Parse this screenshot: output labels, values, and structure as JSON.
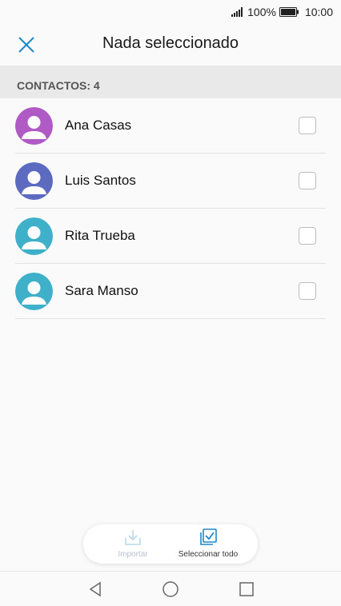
{
  "status_bar": {
    "battery_percent": "100%",
    "time": "10:00"
  },
  "app_bar": {
    "title": "Nada seleccionado",
    "close_icon": "close-icon"
  },
  "section": {
    "label": "CONTACTOS: 4"
  },
  "contacts": [
    {
      "name": "Ana Casas",
      "avatar_color": "#b05ac6",
      "checked": false
    },
    {
      "name": "Luis Santos",
      "avatar_color": "#5c6bc0",
      "checked": false
    },
    {
      "name": "Rita Trueba",
      "avatar_color": "#3fb0c9",
      "checked": false
    },
    {
      "name": "Sara Manso",
      "avatar_color": "#3fb0c9",
      "checked": false
    }
  ],
  "actions": {
    "import_label": "Importar",
    "select_all_label": "Seleccionar todo",
    "import_icon": "import-icon",
    "select_all_icon": "select-all-icon"
  },
  "colors": {
    "accent": "#1e88c8",
    "disabled": "#b8c3cc"
  },
  "nav": {
    "back_icon": "back-icon",
    "home_icon": "home-icon",
    "recents_icon": "recents-icon"
  }
}
